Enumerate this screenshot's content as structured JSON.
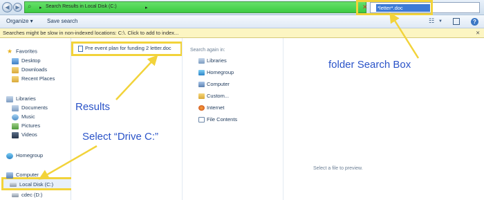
{
  "window": {
    "breadcrumb": "Search Results in Local Disk (C:)",
    "search_query": "*letter*.doc"
  },
  "toolbar": {
    "organize_label": "Organize ▾",
    "save_search_label": "Save search"
  },
  "infobar": {
    "message": "Searches might be slow in non-indexed locations: C:\\. Click to add to index..."
  },
  "nav": {
    "items": [
      {
        "label": "Favorites",
        "icon": "star-icon"
      },
      {
        "label": "Desktop",
        "icon": "desktop-icon"
      },
      {
        "label": "Downloads",
        "icon": "downloads-icon"
      },
      {
        "label": "Recent Places",
        "icon": "recent-places-icon"
      },
      {
        "label": "Libraries",
        "icon": "libraries-icon"
      },
      {
        "label": "Documents",
        "icon": "documents-icon"
      },
      {
        "label": "Music",
        "icon": "music-icon"
      },
      {
        "label": "Pictures",
        "icon": "pictures-icon"
      },
      {
        "label": "Videos",
        "icon": "videos-icon"
      },
      {
        "label": "Homegroup",
        "icon": "homegroup-icon"
      },
      {
        "label": "Computer",
        "icon": "computer-icon"
      },
      {
        "label": "Local Disk (C:)",
        "icon": "disk-icon"
      },
      {
        "label": "cdec (D:)",
        "icon": "disk-icon"
      }
    ]
  },
  "results": {
    "items": [
      {
        "label": "Pre event plan for funding 2 letter.doc",
        "icon": "word-document-icon"
      }
    ]
  },
  "search_again": {
    "title": "Search again in:",
    "items": [
      {
        "label": "Libraries",
        "icon": "libraries-icon"
      },
      {
        "label": "Homegroup",
        "icon": "homegroup-icon"
      },
      {
        "label": "Computer",
        "icon": "computer-icon"
      },
      {
        "label": "Custom...",
        "icon": "custom-folder-icon"
      },
      {
        "label": "Internet",
        "icon": "internet-icon"
      },
      {
        "label": "File Contents",
        "icon": "file-contents-icon"
      }
    ]
  },
  "preview": {
    "message": "Select a file to preview."
  },
  "annotations": {
    "folder_search_box": "folder Search Box",
    "results": "Results",
    "select_drive": "Select “Drive C:”"
  },
  "colors": {
    "highlight": "#f2d33a",
    "annotation_text": "#2a53c8",
    "address_bar": "#3ccb41",
    "search_selection": "#3d7ad6"
  }
}
